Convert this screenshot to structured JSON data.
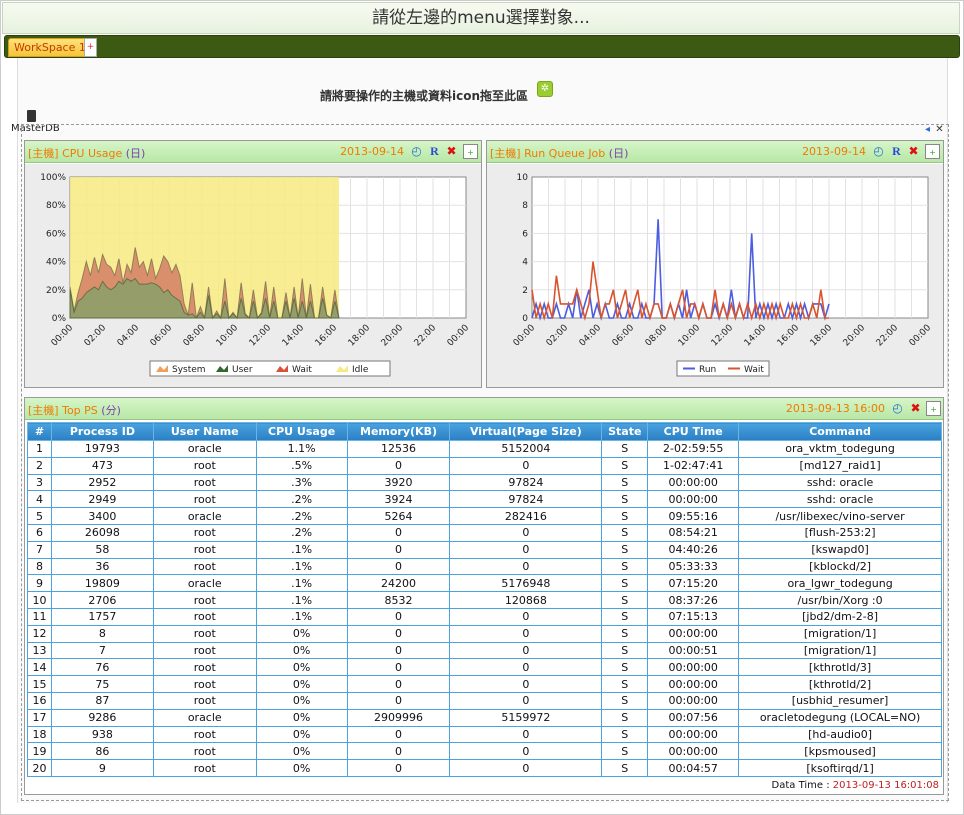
{
  "header": {
    "title": "請從左邊的menu選擇對象..."
  },
  "tabs": [
    {
      "label": "WorkSpace 1"
    }
  ],
  "tab_add_label": "+",
  "drop_hint": "請將要操作的主機或資料icon拖至此區",
  "host": {
    "label": "MasterDB"
  },
  "cpu_panel": {
    "prefix": "[主機]",
    "title": "CPU Usage",
    "unit": "(日)",
    "date": "2013-09-14",
    "chart_data": {
      "type": "area",
      "x_ticks": [
        "00:00",
        "02:00",
        "04:00",
        "06:00",
        "08:00",
        "10:00",
        "12:00",
        "14:00",
        "16:00",
        "18:00",
        "20:00",
        "22:00",
        "00:00"
      ],
      "y_ticks": [
        "0%",
        "20%",
        "40%",
        "60%",
        "80%",
        "100%"
      ],
      "ylim": [
        0,
        100
      ],
      "xlim_hours": [
        0,
        24
      ],
      "data_end_hours": 16.3,
      "legend": [
        "System",
        "User",
        "Wait",
        "Idle"
      ],
      "colors": {
        "System": "#f0a05a",
        "User": "#2f6b2f",
        "Wait": "#d9533a",
        "Idle": "#f8ea80"
      },
      "series": [
        {
          "name": "Wait",
          "values": [
            22,
            5,
            18,
            28,
            40,
            30,
            43,
            32,
            45,
            38,
            36,
            30,
            42,
            25,
            38,
            32,
            50,
            36,
            40,
            30,
            42,
            28,
            35,
            44,
            40,
            32,
            38,
            30,
            10,
            2,
            25,
            0,
            8,
            0,
            22,
            0,
            5,
            0,
            28,
            0,
            4,
            0,
            25,
            3,
            0,
            20,
            0,
            4,
            26,
            0,
            22,
            0,
            0,
            18,
            0,
            22,
            0,
            28,
            0,
            24,
            0,
            0,
            22,
            2,
            0,
            20,
            0
          ]
        },
        {
          "name": "User",
          "values": [
            20,
            4,
            12,
            14,
            18,
            20,
            22,
            20,
            26,
            22,
            20,
            22,
            26,
            24,
            28,
            26,
            28,
            24,
            24,
            24,
            25,
            24,
            22,
            18,
            20,
            16,
            14,
            12,
            4,
            2,
            3,
            0,
            4,
            0,
            16,
            0,
            3,
            0,
            12,
            0,
            3,
            0,
            14,
            2,
            0,
            12,
            0,
            3,
            14,
            0,
            12,
            0,
            0,
            12,
            0,
            14,
            0,
            12,
            0,
            12,
            0,
            0,
            14,
            2,
            0,
            12,
            0
          ]
        }
      ]
    }
  },
  "runq_panel": {
    "prefix": "[主機]",
    "title": "Run Queue Job",
    "unit": "(日)",
    "date": "2013-09-14",
    "chart_data": {
      "type": "line",
      "x_ticks": [
        "00:00",
        "02:00",
        "04:00",
        "06:00",
        "08:00",
        "10:00",
        "12:00",
        "14:00",
        "16:00",
        "18:00",
        "20:00",
        "22:00",
        "00:00"
      ],
      "y_ticks": [
        "0",
        "2",
        "4",
        "6",
        "8",
        "10"
      ],
      "ylim": [
        0,
        10
      ],
      "xlim_hours": [
        0,
        24
      ],
      "legend": [
        "Run",
        "Wait"
      ],
      "colors": {
        "Run": "#4b5de0",
        "Wait": "#d9532e"
      },
      "series": [
        {
          "name": "Run",
          "values": [
            0,
            1,
            0,
            1,
            0,
            0,
            1,
            0,
            0,
            1,
            0,
            2,
            0,
            1,
            2,
            0,
            1,
            0,
            1,
            0,
            0,
            1,
            0,
            0,
            1,
            0,
            0,
            1,
            0,
            0,
            1,
            7,
            0,
            0,
            1,
            0,
            1,
            0,
            2,
            0,
            1,
            0,
            1,
            0,
            0,
            1,
            0,
            1,
            0,
            2,
            0,
            1,
            0,
            0,
            6,
            0,
            1,
            0,
            1,
            0,
            1,
            0,
            0,
            1,
            0,
            1,
            0,
            1,
            0,
            1,
            1,
            1,
            0,
            1
          ]
        },
        {
          "name": "Wait",
          "values": [
            2,
            0,
            1,
            0,
            1,
            0,
            3,
            1,
            1,
            1,
            1,
            2,
            1,
            0,
            1,
            4,
            2,
            0,
            1,
            1,
            2,
            0,
            1,
            2,
            0,
            1,
            2,
            0,
            1,
            0,
            1,
            1,
            0,
            0,
            1,
            0,
            1,
            2,
            0,
            1,
            1,
            0,
            1,
            0,
            0,
            2,
            0,
            1,
            0,
            1,
            0,
            1,
            0,
            1,
            0,
            1,
            0,
            1,
            0,
            1,
            0,
            1,
            0,
            0,
            1,
            0,
            1,
            0,
            0,
            1,
            0,
            2,
            0,
            0
          ]
        }
      ]
    }
  },
  "top_panel": {
    "prefix": "[主機]",
    "title": "Top PS",
    "unit": "(分)",
    "date": "2013-09-13 16:00",
    "columns": [
      "#",
      "Process ID",
      "User Name",
      "CPU Usage",
      "Memory(KB)",
      "Virtual(Page Size)",
      "State",
      "CPU Time",
      "Command"
    ],
    "rows": [
      [
        "1",
        "19793",
        "oracle",
        "1.1%",
        "12536",
        "5152004",
        "S",
        "2-02:59:55",
        "ora_vktm_todegung"
      ],
      [
        "2",
        "473",
        "root",
        ".5%",
        "0",
        "0",
        "S",
        "1-02:47:41",
        "[md127_raid1]"
      ],
      [
        "3",
        "2952",
        "root",
        ".3%",
        "3920",
        "97824",
        "S",
        "00:00:00",
        "sshd: oracle"
      ],
      [
        "4",
        "2949",
        "root",
        ".2%",
        "3924",
        "97824",
        "S",
        "00:00:00",
        "sshd: oracle"
      ],
      [
        "5",
        "3400",
        "oracle",
        ".2%",
        "5264",
        "282416",
        "S",
        "09:55:16",
        "/usr/libexec/vino-server"
      ],
      [
        "6",
        "26098",
        "root",
        ".2%",
        "0",
        "0",
        "S",
        "08:54:21",
        "[flush-253:2]"
      ],
      [
        "7",
        "58",
        "root",
        ".1%",
        "0",
        "0",
        "S",
        "04:40:26",
        "[kswapd0]"
      ],
      [
        "8",
        "36",
        "root",
        ".1%",
        "0",
        "0",
        "S",
        "05:33:33",
        "[kblockd/2]"
      ],
      [
        "9",
        "19809",
        "oracle",
        ".1%",
        "24200",
        "5176948",
        "S",
        "07:15:20",
        "ora_lgwr_todegung"
      ],
      [
        "10",
        "2706",
        "root",
        ".1%",
        "8532",
        "120868",
        "S",
        "08:37:26",
        "/usr/bin/Xorg :0"
      ],
      [
        "11",
        "1757",
        "root",
        ".1%",
        "0",
        "0",
        "S",
        "07:15:13",
        "[jbd2/dm-2-8]"
      ],
      [
        "12",
        "8",
        "root",
        "0%",
        "0",
        "0",
        "S",
        "00:00:00",
        "[migration/1]"
      ],
      [
        "13",
        "7",
        "root",
        "0%",
        "0",
        "0",
        "S",
        "00:00:51",
        "[migration/1]"
      ],
      [
        "14",
        "76",
        "root",
        "0%",
        "0",
        "0",
        "S",
        "00:00:00",
        "[kthrotld/3]"
      ],
      [
        "15",
        "75",
        "root",
        "0%",
        "0",
        "0",
        "S",
        "00:00:00",
        "[kthrotld/2]"
      ],
      [
        "16",
        "87",
        "root",
        "0%",
        "0",
        "0",
        "S",
        "00:00:00",
        "[usbhid_resumer]"
      ],
      [
        "17",
        "9286",
        "oracle",
        "0%",
        "2909996",
        "5159972",
        "S",
        "00:07:56",
        "oracletodegung (LOCAL=NO)"
      ],
      [
        "18",
        "938",
        "root",
        "0%",
        "0",
        "0",
        "S",
        "00:00:00",
        "[hd-audio0]"
      ],
      [
        "19",
        "86",
        "root",
        "0%",
        "0",
        "0",
        "S",
        "00:00:00",
        "[kpsmoused]"
      ],
      [
        "20",
        "9",
        "root",
        "0%",
        "0",
        "0",
        "S",
        "00:04:57",
        "[ksoftirqd/1]"
      ]
    ],
    "data_time_label": "Data Time :",
    "data_time_value": "2013-09-13 16:01:08"
  }
}
